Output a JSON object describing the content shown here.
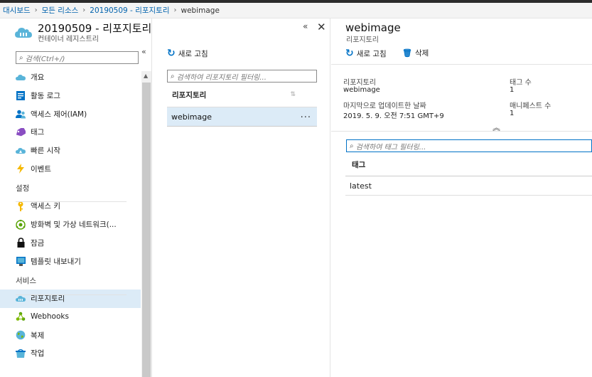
{
  "breadcrumb": [
    "대시보드",
    "모든 리소스",
    "20190509 - 리포지토리",
    "webimage"
  ],
  "left_blade": {
    "title": "20190509 - 리포지토리",
    "subtitle": "컨테이너 레지스트리",
    "search_placeholder": "검색(Ctrl+/)",
    "collapse_glyph": "«",
    "close_glyph": "✕",
    "groups": [
      {
        "items": [
          {
            "label": "개요",
            "icon": "cloud-icon"
          },
          {
            "label": "활동 로그",
            "icon": "activity-log-icon"
          },
          {
            "label": "액세스 제어(IAM)",
            "icon": "people-icon"
          },
          {
            "label": "태그",
            "icon": "tag-icon"
          },
          {
            "label": "빠른 시작",
            "icon": "quickstart-cloud-icon"
          },
          {
            "label": "이벤트",
            "icon": "lightning-icon"
          }
        ]
      },
      {
        "section": "설정",
        "items": [
          {
            "label": "액세스 키",
            "icon": "key-icon"
          },
          {
            "label": "방화벽 및 가상 네트워크(...",
            "icon": "firewall-icon"
          },
          {
            "label": "잠금",
            "icon": "lock-icon"
          },
          {
            "label": "템플릿 내보내기",
            "icon": "template-icon"
          }
        ]
      },
      {
        "section": "서비스",
        "items": [
          {
            "label": "리포지토리",
            "icon": "repository-cloud-icon",
            "active": true
          },
          {
            "label": "Webhooks",
            "icon": "webhooks-icon"
          },
          {
            "label": "복제",
            "icon": "globe-icon"
          },
          {
            "label": "작업",
            "icon": "tasks-icon"
          }
        ]
      }
    ]
  },
  "mid_blade": {
    "refresh_label": "새로 고침",
    "search_placeholder": "검색하여 리포지토리 필터링...",
    "column_header": "리포지토리",
    "rows": [
      {
        "name": "webimage",
        "more": "..."
      }
    ]
  },
  "right_blade": {
    "title": "webimage",
    "subtitle": "리포지토리",
    "refresh_label": "새로 고침",
    "delete_label": "삭제",
    "details": [
      {
        "label": "리포지토리",
        "value": "webimage"
      },
      {
        "label": "태그 수",
        "value": "1"
      },
      {
        "label": "마지막으로 업데이트한 날짜",
        "value": "2019. 5. 9. 오전 7:51 GMT+9"
      },
      {
        "label": "매니페스트 수",
        "value": "1"
      }
    ],
    "tag_search_placeholder": "검색하여 태그 필터링...",
    "tag_header": "태그",
    "tags": [
      "latest"
    ]
  },
  "colors": {
    "accent": "#0072c6",
    "selected_row": "#dcebf7"
  }
}
